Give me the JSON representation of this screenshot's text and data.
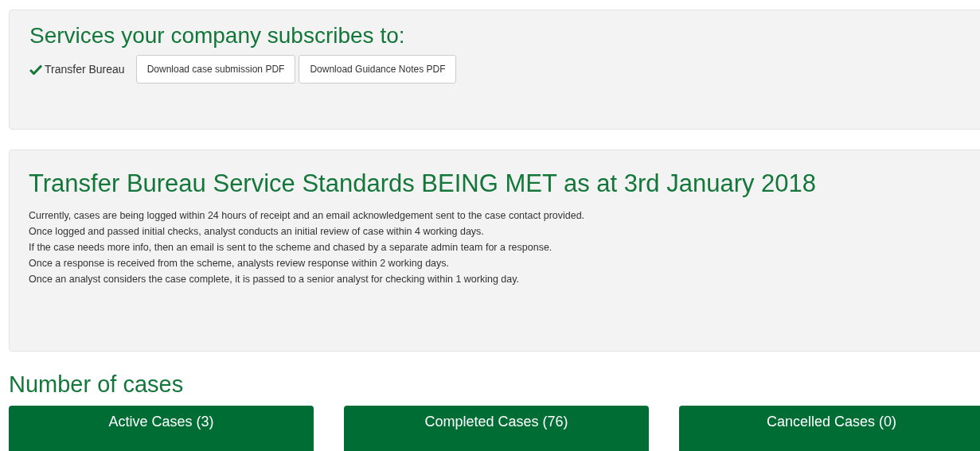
{
  "services_panel": {
    "title": "Services your company subscribes to:",
    "services": [
      {
        "label": "Transfer Bureau",
        "subscribed": true
      }
    ],
    "buttons": [
      "Download case submission PDF",
      "Download Guidance Notes PDF"
    ]
  },
  "standards_panel": {
    "title": "Transfer Bureau Service Standards BEING MET as at 3rd January 2018",
    "lines": [
      "Currently, cases are being logged within 24 hours of receipt and an email acknowledgement sent to the case contact provided.",
      "Once logged and passed initial checks, analyst conducts an initial review of case within 4 working days.",
      "If the case needs more info, then an email is sent to the scheme and chased by a separate admin team for a response.",
      "Once a response is received from the scheme, analysts review response within 2 working days.",
      "Once an analyst considers the case complete, it is passed to a senior analyst for checking within 1 working day."
    ]
  },
  "cases": {
    "title": "Number of cases",
    "buttons": [
      "Active Cases (3)",
      "Completed Cases (76)",
      "Cancelled Cases (0)"
    ]
  }
}
